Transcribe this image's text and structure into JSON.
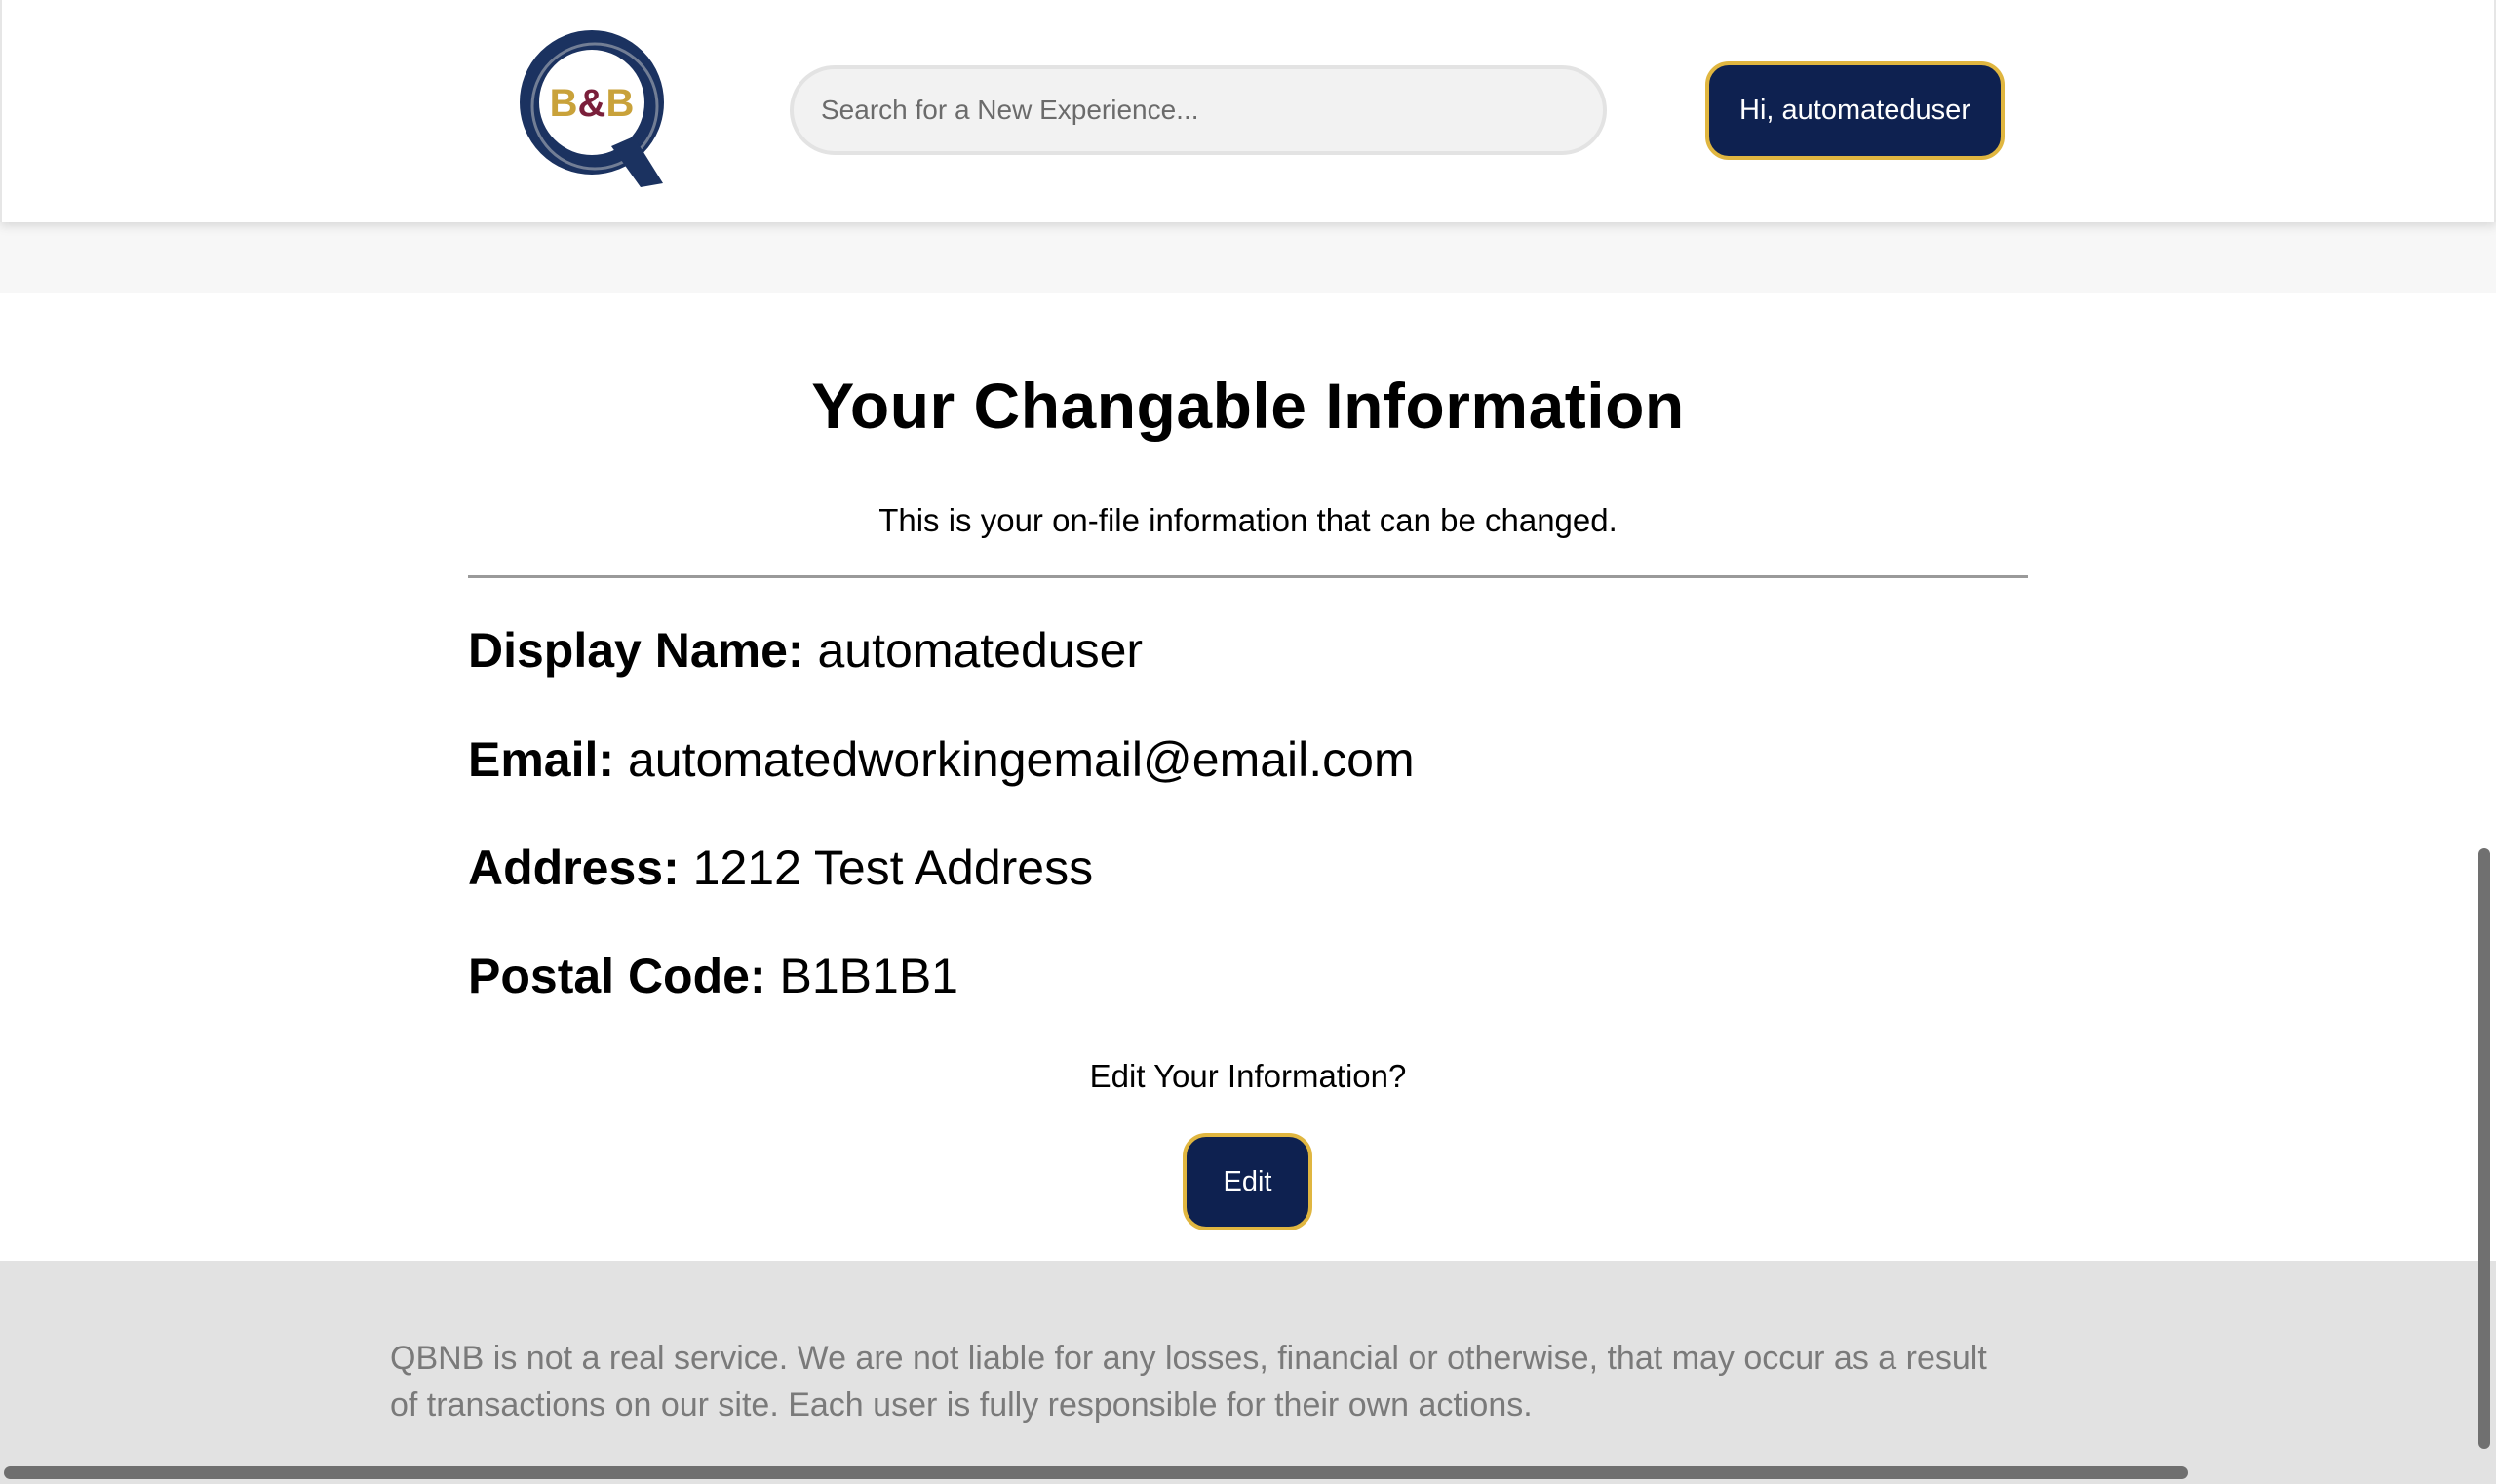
{
  "header": {
    "logo_text": "B&B",
    "logo_colors": {
      "ring": "#1b3260",
      "b": "#c9a23a",
      "ampersand": "#7a1f3a"
    },
    "search_placeholder": "Search for a New Experience...",
    "user_button_label": "Hi, automateduser"
  },
  "main": {
    "title": "Your Changable Information",
    "subtitle": "This is your on-file information that can be changed.",
    "fields": [
      {
        "label": "Display Name:",
        "value": "automateduser"
      },
      {
        "label": "Email:",
        "value": "automatedworkingemail@email.com"
      },
      {
        "label": "Address:",
        "value": "1212 Test Address"
      },
      {
        "label": "Postal Code:",
        "value": "B1B1B1"
      }
    ],
    "edit_prompt": "Edit Your Information?",
    "edit_button_label": "Edit"
  },
  "footer": {
    "disclaimer": "QBNB is not a real service. We are not liable for any losses, financial or otherwise, that may occur as a result of transactions on our site. Each user is fully responsible for their own actions."
  },
  "colors": {
    "button_bg": "#0e2150",
    "button_border": "#e0b640",
    "footer_bg": "#e2e2e2"
  }
}
